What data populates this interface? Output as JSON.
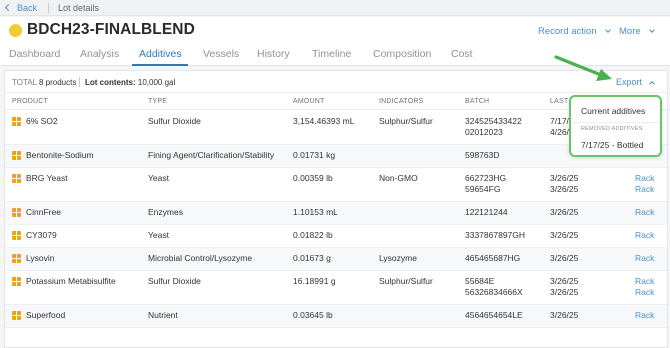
{
  "topbar": {
    "back_label": "Back",
    "breadcrumb": "Lot details"
  },
  "header": {
    "title": "BDCH23-FINALBLEND",
    "record_action_label": "Record action",
    "more_label": "More"
  },
  "tabs": [
    {
      "label": "Dashboard"
    },
    {
      "label": "Analysis"
    },
    {
      "label": "Additives"
    },
    {
      "label": "Vessels"
    },
    {
      "label": "History"
    },
    {
      "label": "Timeline"
    },
    {
      "label": "Composition"
    },
    {
      "label": "Cost"
    }
  ],
  "active_tab": "Additives",
  "summary": {
    "total_label": "TOTAL",
    "products": "8 products",
    "lot_contents_label": "Lot contents:",
    "lot_contents_value": "10,000 gal"
  },
  "export_label": "Export",
  "table": {
    "columns": [
      "PRODUCT",
      "TYPE",
      "AMOUNT",
      "INDICATORS",
      "BATCH",
      "LAST"
    ],
    "rows": [
      {
        "product": "6% SO2",
        "type": "Sulfur Dioxide",
        "amount": "3,154.46393 mL",
        "indicators": "Sulphur/Sulfur",
        "batch": [
          "324525433422",
          "02012023"
        ],
        "last": [
          "7/17/",
          "4/26/"
        ],
        "links": []
      },
      {
        "product": "Bentonite-Sodium",
        "type": "Fining Agent/Clarification/Stability",
        "amount": "0.01731 kg",
        "indicators": "",
        "batch": [
          "598763D"
        ],
        "last": [],
        "links": []
      },
      {
        "product": "BRG Yeast",
        "type": "Yeast",
        "amount": "0.00359 lb",
        "indicators": "Non-GMO",
        "batch": [
          "662723HG",
          "59654FG"
        ],
        "last": [
          "3/26/25",
          "3/26/25"
        ],
        "links": [
          "Rack",
          "Rack"
        ]
      },
      {
        "product": "CinnFree",
        "type": "Enzymes",
        "amount": "1.10153 mL",
        "indicators": "",
        "batch": [
          "122121244"
        ],
        "last": [
          "3/26/25"
        ],
        "links": [
          "Rack"
        ]
      },
      {
        "product": "CY3079",
        "type": "Yeast",
        "amount": "0.01822 lb",
        "indicators": "",
        "batch": [
          "3337867897GH"
        ],
        "last": [
          "3/26/25"
        ],
        "links": [
          "Rack"
        ]
      },
      {
        "product": "Lysovin",
        "type": "Microbial Control/Lysozyme",
        "amount": "0.01673 g",
        "indicators": "Lysozyme",
        "batch": [
          "465465687HG"
        ],
        "last": [
          "3/26/25"
        ],
        "links": [
          "Rack"
        ]
      },
      {
        "product": "Potassium Metabisulfite",
        "type": "Sulfur Dioxide",
        "amount": "16.18991 g",
        "indicators": "Sulphur/Sulfur",
        "batch": [
          "55684E",
          "56326834666X"
        ],
        "last": [
          "3/26/25",
          "3/26/25"
        ],
        "links": [
          "Rack",
          "Rack"
        ]
      },
      {
        "product": "Superfood",
        "type": "Nutrient",
        "amount": "0.03645 lb",
        "indicators": "",
        "batch": [
          "4564654654LE"
        ],
        "last": [
          "3/26/25"
        ],
        "links": [
          "Rack"
        ]
      }
    ]
  },
  "dropdown": {
    "current_label": "Current additives",
    "removed_label": "REMOVED ADDITIVES",
    "removed_item": "7/17/25 - Bottled"
  },
  "colors": {
    "accent": "#2f79b9",
    "link": "#4a90c8",
    "lot_dot": "#f0cc2e",
    "product_icon": "#f0a020",
    "highlight": "#4caf50"
  }
}
